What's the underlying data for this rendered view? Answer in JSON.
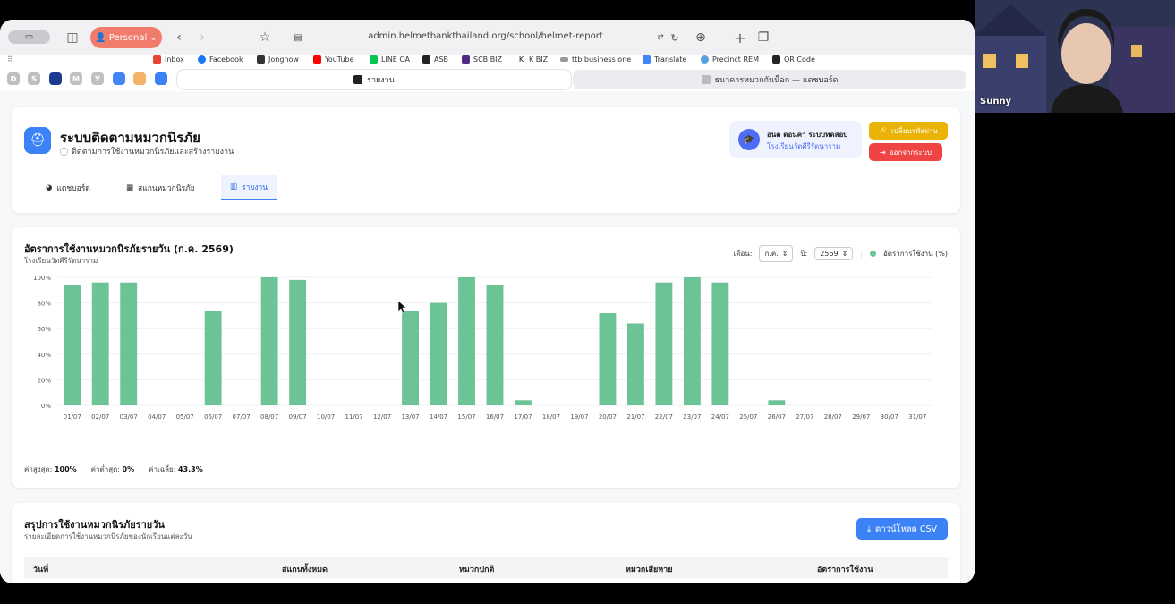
{
  "browser": {
    "profile_label": "Personal",
    "url": "admin.helmetbankthailand.org/school/helmet-report",
    "bookmarks": [
      "Inbox",
      "Facebook",
      "Jongnow",
      "YouTube",
      "LINE OA",
      "ASB",
      "SCB BIZ",
      "K BIZ",
      "ttb business one",
      "Translate",
      "Precinct REM",
      "QR Code"
    ],
    "pinned": [
      "D",
      "S",
      "",
      "M",
      "Y",
      "",
      "",
      ""
    ],
    "tabs": [
      {
        "label": "รายงาน",
        "active": true
      },
      {
        "label": "ธนาคารหมวกกันน็อก — แดชบอร์ด",
        "active": false
      }
    ]
  },
  "app": {
    "title": "ระบบติดตามหมวกนิรภัย",
    "subtitle": "ติดตามการใช้งานหมวกนิรภัยและสร้างรายงาน",
    "user_name": "อนต ดอนคา ระบบทดสอบ",
    "user_school": "โรงเรียนวัดศีรีรัตนาราม",
    "change_password_label": "เปลี่ยนรหัสผ่าน",
    "logout_label": "ออกจากระบบ",
    "nav_tabs": [
      {
        "label": "แดชบอร์ด",
        "active": false
      },
      {
        "label": "สแกนหมวกนิรภัย",
        "active": false
      },
      {
        "label": "รายงาน",
        "active": true
      }
    ]
  },
  "chart_section": {
    "title": "อัตราการใช้งานหมวกนิรภัยรายวัน (ก.ค. 2569)",
    "subtitle": "โรงเรียนวัดศีรีรัตนาราม",
    "month_label": "เดือน:",
    "month_value": "ก.ค.",
    "year_label": "ปี:",
    "year_value": "2569",
    "legend_label": "อัตราการใช้งาน (%)",
    "stats": {
      "max_label": "ค่าสูงสุด:",
      "max_value": "100%",
      "min_label": "ค่าต่ำสุด:",
      "min_value": "0%",
      "avg_label": "ค่าเฉลี่ย:",
      "avg_value": "43.3%"
    }
  },
  "chart_data": {
    "type": "bar",
    "categories": [
      "01/07",
      "02/07",
      "03/07",
      "04/07",
      "05/07",
      "06/07",
      "07/07",
      "08/07",
      "09/07",
      "10/07",
      "11/07",
      "12/07",
      "13/07",
      "14/07",
      "15/07",
      "16/07",
      "17/07",
      "18/07",
      "19/07",
      "20/07",
      "21/07",
      "22/07",
      "23/07",
      "24/07",
      "25/07",
      "26/07",
      "27/07",
      "28/07",
      "29/07",
      "30/07",
      "31/07"
    ],
    "values": [
      94,
      96,
      96,
      0,
      0,
      74,
      0,
      100,
      98,
      0,
      0,
      0,
      74,
      80,
      100,
      94,
      4,
      0,
      0,
      72,
      64,
      96,
      100,
      96,
      0,
      4,
      0,
      0,
      0,
      0,
      0
    ],
    "yticks": [
      "0%",
      "20%",
      "40%",
      "60%",
      "80%",
      "100%"
    ],
    "ylim": [
      0,
      100
    ],
    "color": "#6cc496",
    "grid": true
  },
  "table_section": {
    "title": "สรุปการใช้งานหมวกนิรภัยรายวัน",
    "subtitle": "รายละเอียดการใช้งานหมวกนิรภัยของนักเรียนแต่ละวัน",
    "download_label": "ดาวน์โหลด CSV",
    "columns": [
      "วันที่",
      "สแกนทั้งหมด",
      "หมวกปกติ",
      "หมวกเสียหาย",
      "อัตราการใช้งาน"
    ]
  },
  "webcam": {
    "name": "Sunny"
  }
}
